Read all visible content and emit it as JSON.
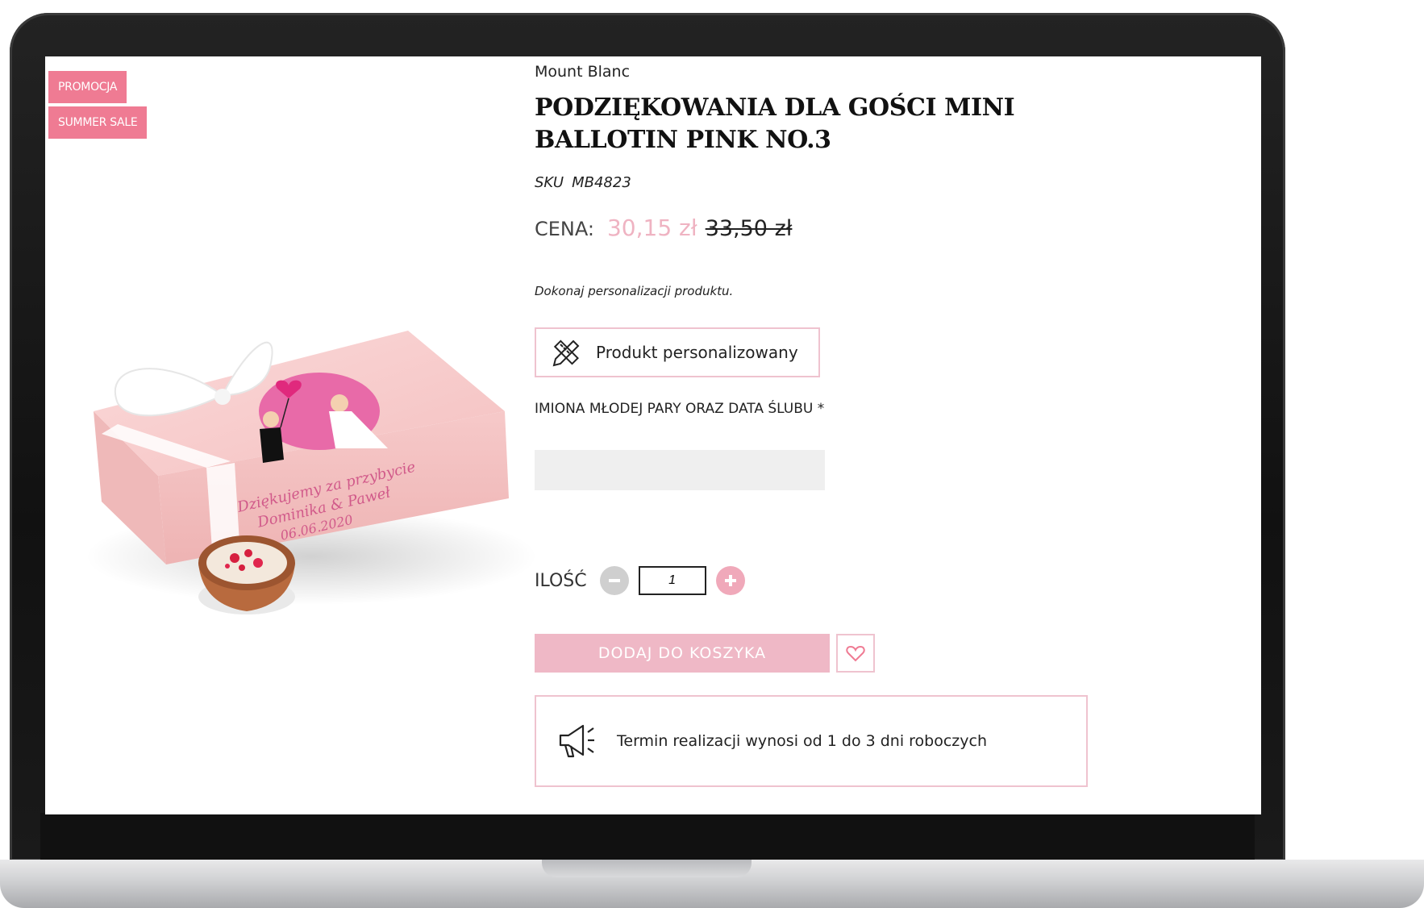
{
  "badges": {
    "promo": "PROMOCJA",
    "sale": "SUMMER SALE"
  },
  "product": {
    "brand": "Mount Blanc",
    "title": "PODZIĘKOWANIA DLA GOŚCI MINI BALLOTIN PINK NO.3",
    "sku_label": "SKU",
    "sku_value": "MB4823",
    "price_label": "CENA:",
    "price_new": "30,15 zł",
    "price_old": "33,50 zł",
    "personalize_note": "Dokonaj personalizacji produktu.",
    "personalized_label": "Produkt personalizowany",
    "field_label": "IMIONA MŁODEJ PARY ORAZ DATA ŚLUBU *",
    "field_value": "",
    "image_text": {
      "line1": "Dziękujemy za przybycie",
      "line2": "Dominika & Paweł",
      "line3": "06.06.2020"
    }
  },
  "quantity": {
    "label": "ILOŚĆ",
    "value": "1"
  },
  "cart": {
    "add_label": "DODAJ DO KOSZYKA"
  },
  "delivery": {
    "text": "Termin realizacji wynosi od 1 do 3 dni roboczych"
  },
  "colors": {
    "badge": "#ef7b93",
    "accent_pink": "#efb8c6",
    "price_new": "#efb3c2",
    "box_border": "#efc3cf"
  },
  "icons": {
    "personalize": "pencil-ruler-icon",
    "delivery": "megaphone-icon",
    "wishlist": "heart-icon",
    "minus": "minus-circle-icon",
    "plus": "plus-circle-icon"
  }
}
